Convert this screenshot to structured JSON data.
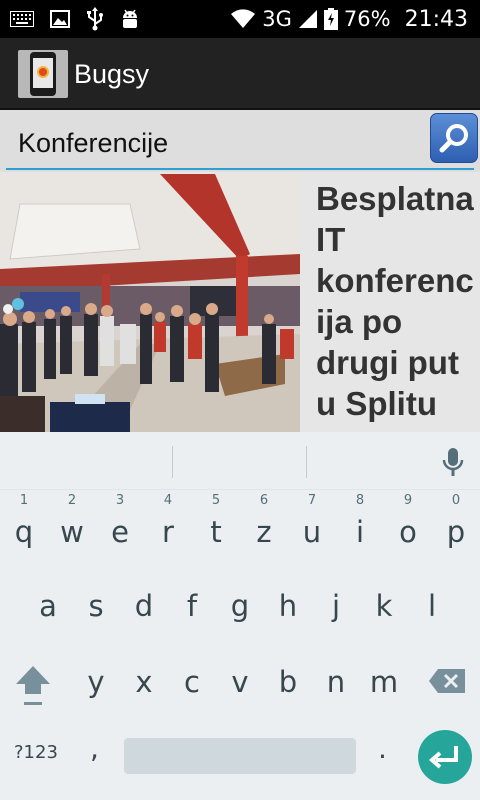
{
  "status_bar": {
    "network": "3G",
    "battery": "76%",
    "time": "21:43",
    "icons": [
      "keyboard-icon",
      "image-icon",
      "usb-icon",
      "android-icon",
      "wifi-icon",
      "signal-icon",
      "battery-icon"
    ]
  },
  "app_bar": {
    "title": "Bugsy"
  },
  "search": {
    "value": "Konferencije",
    "button_icon": "search-icon"
  },
  "news": {
    "title": "Besplatna IT konferencija po drugi put u Splitu"
  },
  "keyboard": {
    "row1": [
      {
        "letter": "q",
        "hint": "1"
      },
      {
        "letter": "w",
        "hint": "2"
      },
      {
        "letter": "e",
        "hint": "3"
      },
      {
        "letter": "r",
        "hint": "4"
      },
      {
        "letter": "t",
        "hint": "5"
      },
      {
        "letter": "z",
        "hint": "6"
      },
      {
        "letter": "u",
        "hint": "7"
      },
      {
        "letter": "i",
        "hint": "8"
      },
      {
        "letter": "o",
        "hint": "9"
      },
      {
        "letter": "p",
        "hint": "0"
      }
    ],
    "row2": [
      "a",
      "s",
      "d",
      "f",
      "g",
      "h",
      "j",
      "k",
      "l"
    ],
    "row3": [
      "y",
      "x",
      "c",
      "v",
      "b",
      "n",
      "m"
    ],
    "symbols_label": "?123",
    "comma": ",",
    "period": ".",
    "colors": {
      "enter": "#26a69a",
      "background": "#eceff1"
    }
  }
}
